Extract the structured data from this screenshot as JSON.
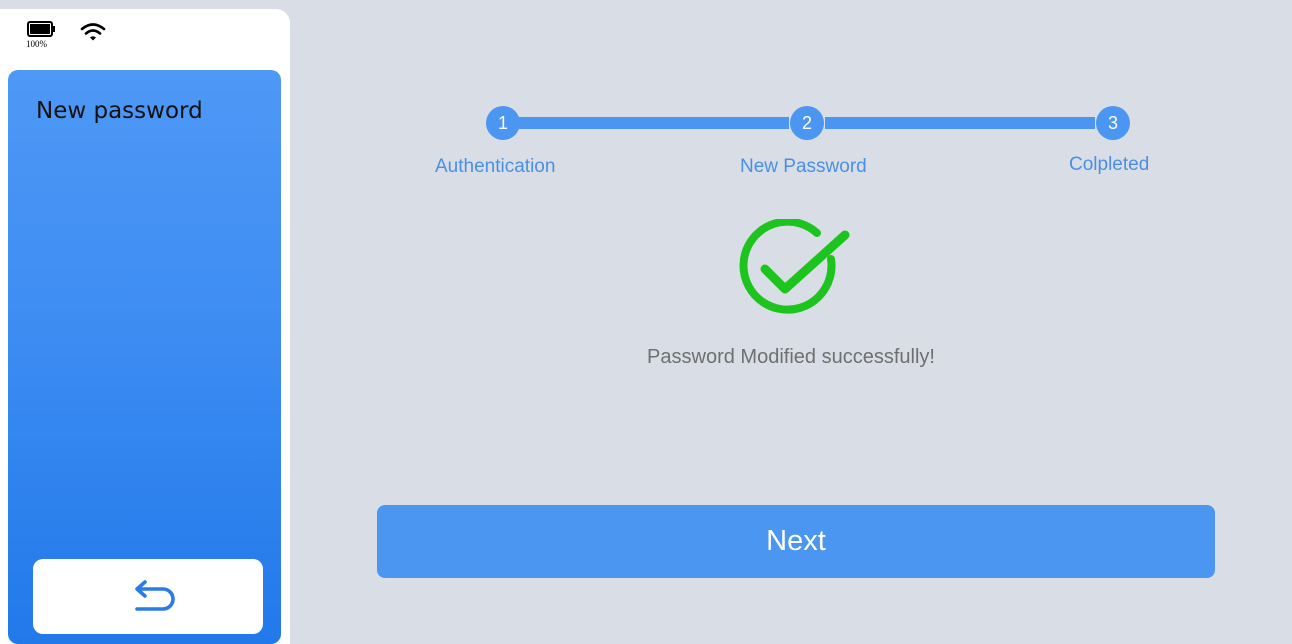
{
  "status_bar": {
    "battery_icon": "battery-full-icon",
    "battery_percent": "100%",
    "wifi_icon": "wifi-icon"
  },
  "sidebar": {
    "title": "New password",
    "back_icon": "back-arrow-icon"
  },
  "stepper": {
    "steps": [
      {
        "number": "1",
        "label": "Authentication"
      },
      {
        "number": "2",
        "label": "New Password"
      },
      {
        "number": "3",
        "label": "Colpleted"
      }
    ],
    "current_step": 3
  },
  "result": {
    "icon": "success-check-icon",
    "message": "Password Modified successfully!"
  },
  "actions": {
    "next_label": "Next"
  },
  "colors": {
    "accent": "#4a96f0",
    "sidebar_top": "#4e98f6",
    "sidebar_bottom": "#2279ea",
    "success": "#1ec41e",
    "background": "#d9dee6"
  }
}
